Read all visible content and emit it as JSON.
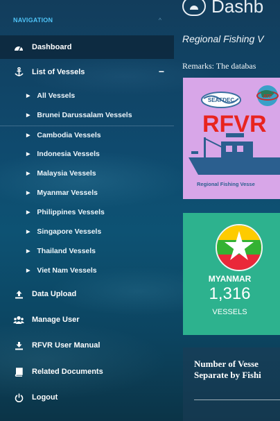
{
  "nav": {
    "header": "NAVIGATION",
    "items": [
      {
        "label": "Dashboard",
        "icon": "dashboard-icon",
        "active": true
      },
      {
        "label": "List of Vessels",
        "icon": "anchor-icon",
        "toggle": "−"
      },
      {
        "label": "Data Upload",
        "icon": "upload-icon"
      },
      {
        "label": "Manage User",
        "icon": "users-icon"
      },
      {
        "label": "RFVR User Manual",
        "icon": "download-icon"
      },
      {
        "label": "Related Documents",
        "icon": "book-icon"
      },
      {
        "label": "Logout",
        "icon": "power-icon"
      }
    ],
    "vessels": [
      "All Vessels",
      "Brunei Darussalam Vessels",
      "Cambodia Vessels",
      "Indonesia Vessels",
      "Malaysia Vessels",
      "Myanmar Vessels",
      "Philippines Vessels",
      "Singapore Vessels",
      "Thailand Vessels",
      "Viet Nam Vessels"
    ]
  },
  "main": {
    "title": "Dashb",
    "subtitle": "Regional Fishing V",
    "remarks": "Remarks: The databas",
    "logo": {
      "text": "RFVR",
      "caption": "Regional Fishing Vesse",
      "org1": "SEAFDEC",
      "org2": "ATF"
    },
    "country_card": {
      "name": "MYANMAR",
      "count": "1,316",
      "unit": "VESSELS"
    },
    "stat": {
      "line1": "Number of Vesse",
      "line2": "Separate by Fishi"
    }
  },
  "colors": {
    "accent_header": "#4fc3f7",
    "card_purple": "#d8a6e8",
    "card_green": "#2db28e",
    "rfvr_red": "#e8241f",
    "ship_blue": "#2b5f8f"
  }
}
